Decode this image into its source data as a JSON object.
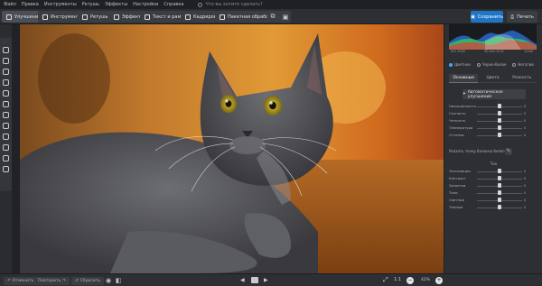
{
  "menu": [
    "Файл",
    "Правка",
    "Инструменты",
    "Ретушь",
    "Эффекты",
    "Настройки",
    "Справка"
  ],
  "search_placeholder": "Что вы хотите сделать?",
  "toolbar": {
    "tabs": [
      "Улучшения",
      "Инструменты",
      "Ретушь",
      "Эффекты",
      "Текст и рамки",
      "Кадрирование",
      "Пакетная обработка"
    ],
    "save_label": "Сохранить",
    "print_label": "Печать"
  },
  "histogram": {
    "iso": "ISO 2500",
    "lens": "50 mm f/1.8",
    "shutter": "1/160"
  },
  "view_modes": {
    "options": [
      "Цветное",
      "Черно-белое",
      "Негатив"
    ],
    "selected": 0
  },
  "panel_tabs": {
    "items": [
      "Основные",
      "Цвета",
      "Резкость"
    ],
    "active": 0
  },
  "auto_button": "Автоматическое улучшение",
  "sliders_top": [
    {
      "label": "Насыщенность",
      "value": "0",
      "knob": 0.5
    },
    {
      "label": "Сочность",
      "value": "0",
      "knob": 0.5
    },
    {
      "label": "Четкость",
      "value": "0",
      "knob": 0.5
    },
    {
      "label": "Температура",
      "value": "0",
      "knob": 0.5
    },
    {
      "label": "Оттенок",
      "value": "0",
      "knob": 0.5
    }
  ],
  "white_balance": "Указать точку баланса белого",
  "tone_heading": "Тон",
  "sliders_bottom": [
    {
      "label": "Экспозиция",
      "value": "0",
      "knob": 0.5
    },
    {
      "label": "Контраст",
      "value": "0",
      "knob": 0.5
    },
    {
      "label": "Засветки",
      "value": "0",
      "knob": 0.5
    },
    {
      "label": "Тени",
      "value": "0",
      "knob": 0.5
    },
    {
      "label": "Светлые",
      "value": "0",
      "knob": 0.5
    },
    {
      "label": "Темные",
      "value": "0",
      "knob": 0.5
    }
  ],
  "bottom": {
    "undo": "Отменить",
    "redo": "Повторить",
    "reset": "Сбросить",
    "zoom_ratio": "1:1",
    "zoom_percent": "42%"
  },
  "colors": {
    "accent": "#1f74c5",
    "panel": "#2d2f33",
    "background": "#2a2c30"
  }
}
